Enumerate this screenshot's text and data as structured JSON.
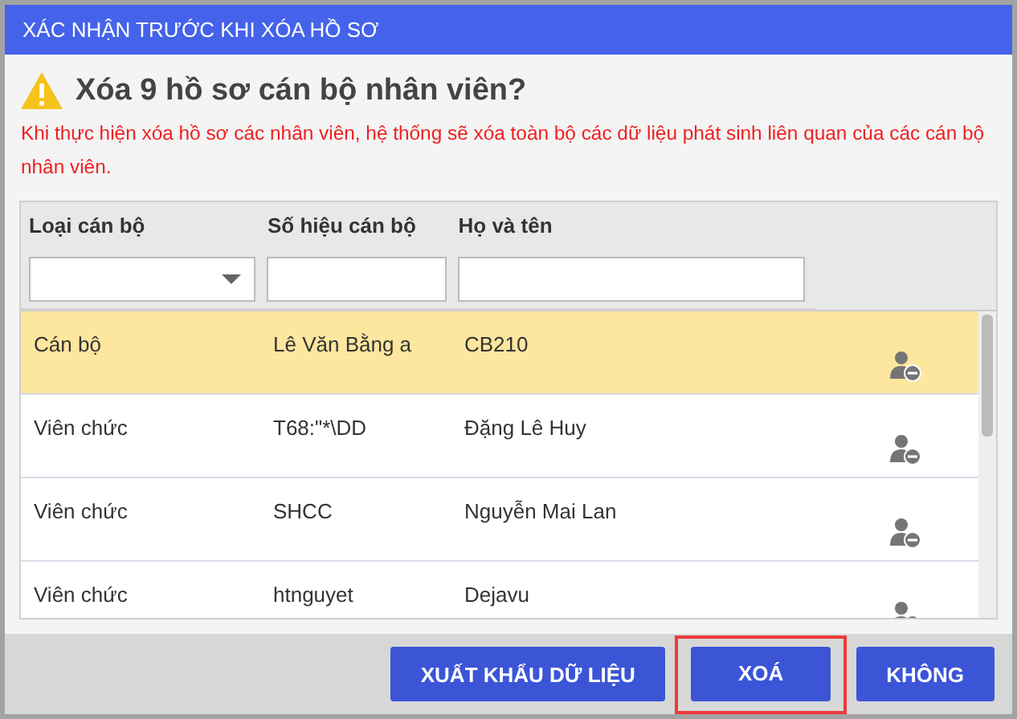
{
  "dialog": {
    "title": "XÁC NHẬN TRƯỚC KHI XÓA HỒ SƠ",
    "heading": "Xóa 9 hồ sơ cán bộ nhân viên?",
    "warning": "Khi thực hiện xóa hồ sơ các nhân viên, hệ thống sẽ xóa toàn bộ các dữ liệu phát sinh liên quan của các cán bộ nhân viên."
  },
  "table": {
    "columns": [
      {
        "label": "Loại cán bộ",
        "kind": "dropdown"
      },
      {
        "label": "Số hiệu cán bộ",
        "kind": "text"
      },
      {
        "label": "Họ và tên",
        "kind": "text"
      }
    ],
    "rows": [
      {
        "cells": [
          "Cán bộ",
          "Lê Văn Bằng a",
          "CB210"
        ],
        "selected": true
      },
      {
        "cells": [
          "Viên chức",
          "T68:\"*\\DD",
          "Đặng Lê Huy"
        ],
        "selected": false
      },
      {
        "cells": [
          "Viên chức",
          "SHCC",
          "Nguyễn Mai Lan"
        ],
        "selected": false
      },
      {
        "cells": [
          "Viên chức",
          "htnguyet",
          "Dejavu"
        ],
        "selected": false
      }
    ]
  },
  "buttons": [
    {
      "label": "XUẤT KHẨU DỮ LIỆU",
      "highlighted": false
    },
    {
      "label": "XOÁ",
      "highlighted": true
    },
    {
      "label": "KHÔNG",
      "highlighted": false
    }
  ]
}
